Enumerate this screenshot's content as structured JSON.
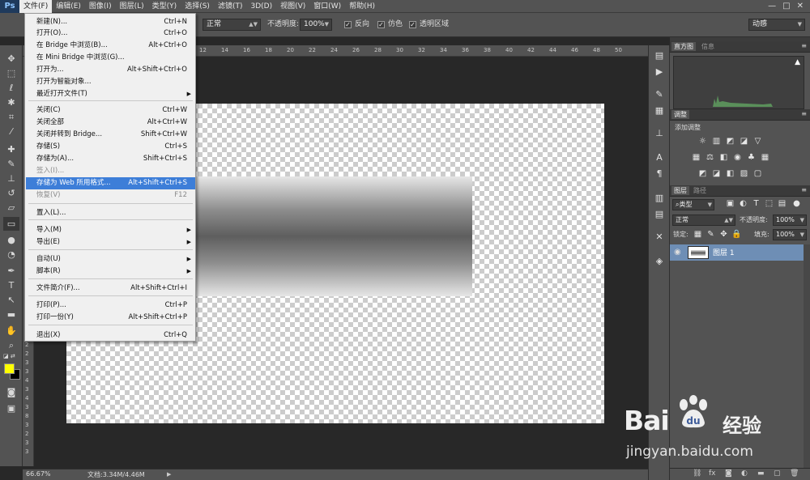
{
  "app": {
    "logo": "Ps"
  },
  "menubar": {
    "items": [
      "文件(F)",
      "编辑(E)",
      "图像(I)",
      "图层(L)",
      "类型(Y)",
      "选择(S)",
      "滤镜(T)",
      "3D(D)",
      "视图(V)",
      "窗口(W)",
      "帮助(H)"
    ],
    "window_controls": [
      "—",
      "□",
      "✕"
    ]
  },
  "options_bar": {
    "mode_value": "正常",
    "opacity_label": "不透明度:",
    "opacity_value": "100%",
    "reverse_label": "反向",
    "dither_label": "仿色",
    "transparency_label": "透明区域",
    "workspace_value": "动感"
  },
  "file_menu": {
    "items": [
      {
        "label": "新建(N)...",
        "shortcut": "Ctrl+N"
      },
      {
        "label": "打开(O)...",
        "shortcut": "Ctrl+O"
      },
      {
        "label": "在 Bridge 中浏览(B)...",
        "shortcut": "Alt+Ctrl+O"
      },
      {
        "label": "在 Mini Bridge 中浏览(G)...",
        "shortcut": ""
      },
      {
        "label": "打开为...",
        "shortcut": "Alt+Shift+Ctrl+O"
      },
      {
        "label": "打开为智能对象...",
        "shortcut": ""
      },
      {
        "label": "最近打开文件(T)",
        "shortcut": ""
      },
      {
        "label": "关闭(C)",
        "shortcut": "Ctrl+W"
      },
      {
        "label": "关闭全部",
        "shortcut": "Alt+Ctrl+W"
      },
      {
        "label": "关闭并转到 Bridge...",
        "shortcut": "Shift+Ctrl+W"
      },
      {
        "label": "存储(S)",
        "shortcut": "Ctrl+S"
      },
      {
        "label": "存储为(A)...",
        "shortcut": "Shift+Ctrl+S"
      },
      {
        "label": "签入(I)...",
        "shortcut": ""
      },
      {
        "label": "存储为 Web 所用格式...",
        "shortcut": "Alt+Shift+Ctrl+S"
      },
      {
        "label": "恢复(V)",
        "shortcut": "F12"
      },
      {
        "label": "置入(L)...",
        "shortcut": ""
      },
      {
        "label": "导入(M)",
        "shortcut": ""
      },
      {
        "label": "导出(E)",
        "shortcut": ""
      },
      {
        "label": "自动(U)",
        "shortcut": ""
      },
      {
        "label": "脚本(R)",
        "shortcut": ""
      },
      {
        "label": "文件简介(F)...",
        "shortcut": "Alt+Shift+Ctrl+I"
      },
      {
        "label": "打印(P)...",
        "shortcut": "Ctrl+P"
      },
      {
        "label": "打印一份(Y)",
        "shortcut": "Alt+Shift+Ctrl+P"
      },
      {
        "label": "退出(X)",
        "shortcut": "Ctrl+Q"
      }
    ]
  },
  "ruler_top": [
    "12",
    "14",
    "16",
    "18",
    "20",
    "22",
    "24",
    "26",
    "28",
    "30",
    "32",
    "34",
    "36",
    "38",
    "40",
    "42",
    "44",
    "46",
    "48",
    "50"
  ],
  "ruler_left": [
    "2",
    "2",
    "3",
    "3",
    "4",
    "3",
    "4",
    "3",
    "8",
    "3",
    "2",
    "3",
    "3"
  ],
  "status_bar": {
    "zoom": "66.67%",
    "doc": "文档:3.34M/4.46M",
    "arrow": "▶"
  },
  "panels": {
    "histogram": {
      "tabs": [
        "直方图",
        "信息"
      ],
      "warning": "▲"
    },
    "adjustments": {
      "tabs": [
        "调整"
      ],
      "add_label": "添加调整"
    },
    "layers": {
      "tabs": [
        "图层",
        "路径"
      ],
      "kind_filter": "类型",
      "blend_mode": "正常",
      "opacity_label": "不透明度:",
      "opacity_value": "100%",
      "lock_label": "锁定:",
      "fill_label": "填充:",
      "fill_value": "100%",
      "layer_name": "图层 1"
    }
  },
  "watermark": {
    "brand": "Bai",
    "brand2": "经验",
    "url": "jingyan.baidu.com"
  },
  "colors": {
    "accent": "#3d7ed8",
    "foreground": "#ffff00",
    "background": "#000000"
  }
}
